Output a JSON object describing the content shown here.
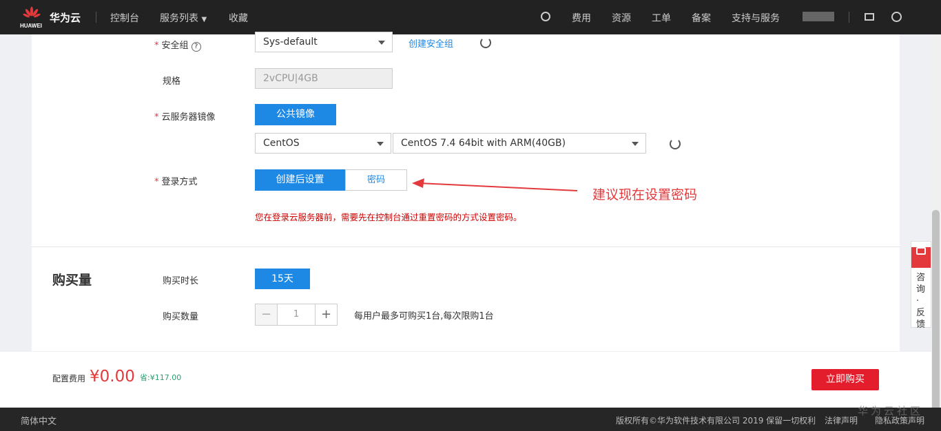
{
  "header": {
    "brand": "华为云",
    "logo_text": "HUAWEI",
    "nav": [
      "控制台",
      "服务列表",
      "收藏"
    ],
    "right": [
      "费用",
      "资源",
      "工单",
      "备案",
      "支持与服务"
    ]
  },
  "form": {
    "security_group": {
      "label": "安全组",
      "value": "Sys-default",
      "create_link": "创建安全组"
    },
    "spec": {
      "label": "规格",
      "value": "2vCPU|4GB"
    },
    "image": {
      "label": "云服务器镜像",
      "tab": "公共镜像",
      "os": "CentOS",
      "version": "CentOS 7.4 64bit with ARM(40GB)"
    },
    "login": {
      "label": "登录方式",
      "options": [
        "创建后设置",
        "密码"
      ],
      "warning": "您在登录云服务器前，需要先在控制台通过重置密码的方式设置密码。",
      "annotation": "建议现在设置密码"
    }
  },
  "purchase": {
    "title": "购买量",
    "duration_label": "购买时长",
    "duration": "15天",
    "qty_label": "购买数量",
    "qty": "1",
    "qty_note": "每用户最多可购买1台,每次限购1台"
  },
  "bottom": {
    "fee_label": "配置费用",
    "price": "¥0.00",
    "save": "省:¥117.00",
    "buy": "立即购买"
  },
  "feedback": {
    "text": "咨询·反馈"
  },
  "footer": {
    "lang": "简体中文",
    "copyright": "版权所有©华为软件技术有限公司 2019 保留一切权利",
    "legal": "法律声明",
    "privacy": "隐私政策声明",
    "watermark": "华为云社区"
  },
  "colors": {
    "accent": "#1e88e5",
    "danger": "#e4393c"
  }
}
